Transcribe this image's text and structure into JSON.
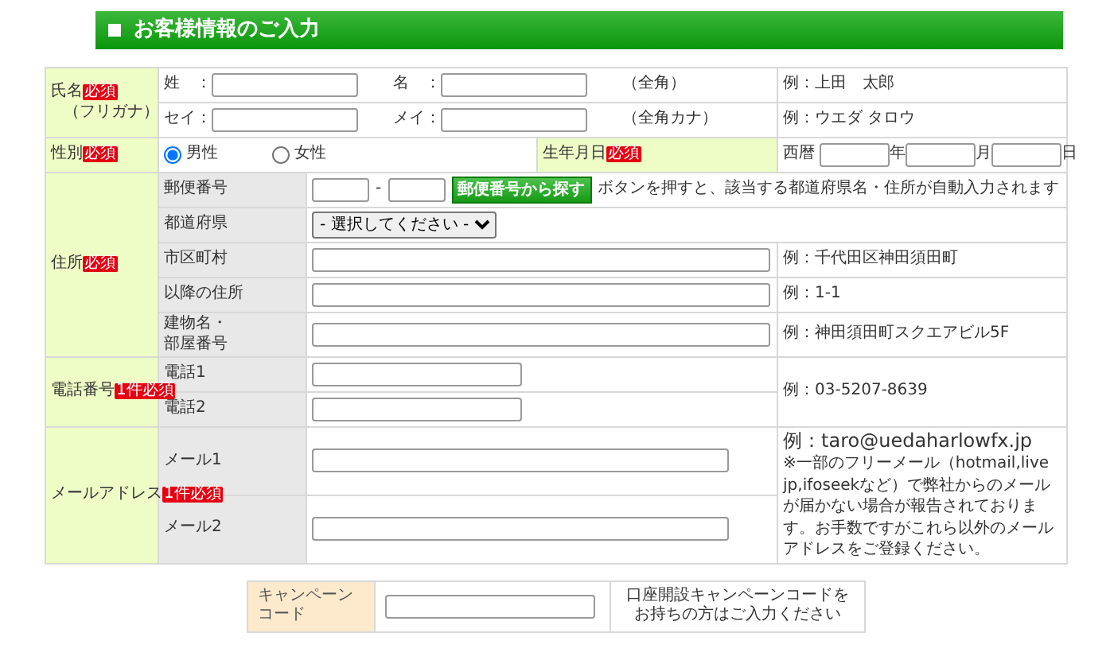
{
  "section_title": "お客様情報のご入力",
  "name_section": {
    "label": "氏名",
    "badge": "必須",
    "note": "（フリガナ）",
    "rows": [
      {
        "fields": [
          "姓　：",
          "名　："
        ],
        "hint": "（全角）",
        "example": "例：上田　太郎"
      },
      {
        "fields": [
          "セイ：",
          "メイ："
        ],
        "hint": "（全角カナ）",
        "example": "例：ウエダ タロウ"
      }
    ]
  },
  "gender": {
    "label": "性別",
    "badge": "必須",
    "options": [
      {
        "label": "男性",
        "selected": true
      },
      {
        "label": "女性",
        "selected": false
      }
    ]
  },
  "birthdate": {
    "label": "生年月日",
    "badge": "必須",
    "prefix": "西暦",
    "units": [
      "年",
      "月",
      "日"
    ]
  },
  "address": {
    "label": "住所",
    "badge": "必須",
    "rows": [
      {
        "kind": "postcode",
        "label": "郵便番号",
        "separator": "-",
        "button": "郵便番号から探す",
        "note": "ボタンを押すと、該当する都道府県名・住所が自動入力されます"
      },
      {
        "kind": "select",
        "label": "都道府県",
        "value": "- 選択してください -"
      },
      {
        "kind": "text",
        "label": "市区町村",
        "example": "例：千代田区神田須田町"
      },
      {
        "kind": "text",
        "label": "以降の住所",
        "example": "例：1-1"
      },
      {
        "kind": "text",
        "label": "建物名・部屋番号",
        "example": "例：神田須田町スクエアビル5F"
      }
    ]
  },
  "phone": {
    "label": "電話番号",
    "badge": "1件必須",
    "rows": [
      {
        "label": "電話1"
      },
      {
        "label": "電話2"
      }
    ],
    "example": "例：03-5207-8639"
  },
  "email": {
    "label": "メールアドレス",
    "badge": "1件必須",
    "rows": [
      {
        "label": "メール1"
      },
      {
        "label": "メール2"
      }
    ],
    "example": "例：taro@uedaharlowfx.jp",
    "note": "※一部のフリーメール（hotmail,live jp,ifoseekなど）で弊社からのメールが届かない場合が報告されております。お手数ですがこれら以外のメールアドレスをご登録ください。"
  },
  "campaign": {
    "label": "キャンペーンコード",
    "note": "口座開設キャンペーンコードをお持ちの方はご入力ください"
  }
}
